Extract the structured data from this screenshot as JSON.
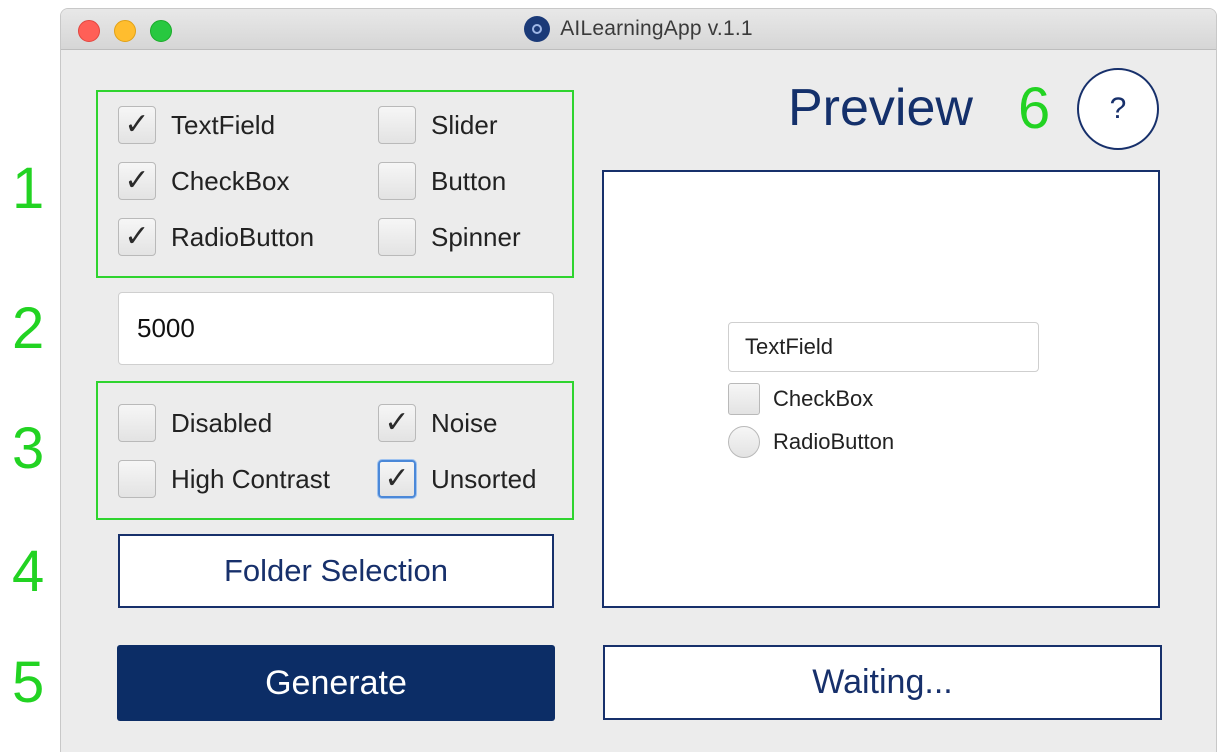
{
  "window": {
    "title": "AILearningApp v.1.1"
  },
  "annotations": [
    "1",
    "2",
    "3",
    "4",
    "5",
    "6"
  ],
  "components": [
    {
      "label": "TextField",
      "checked": true
    },
    {
      "label": "CheckBox",
      "checked": true
    },
    {
      "label": "RadioButton",
      "checked": true
    },
    {
      "label": "Slider",
      "checked": false
    },
    {
      "label": "Button",
      "checked": false
    },
    {
      "label": "Spinner",
      "checked": false
    }
  ],
  "count_input": {
    "value": "5000"
  },
  "options": [
    {
      "label": "Disabled",
      "checked": false
    },
    {
      "label": "High Contrast",
      "checked": false
    },
    {
      "label": "Noise",
      "checked": true
    },
    {
      "label": "Unsorted",
      "checked": true
    }
  ],
  "folder_button": {
    "label": "Folder Selection"
  },
  "generate_button": {
    "label": "Generate"
  },
  "preview": {
    "title": "Preview",
    "help_label": "?",
    "textfield_label": "TextField",
    "checkbox_label": "CheckBox",
    "radio_label": "RadioButton"
  },
  "status": {
    "label": "Waiting..."
  },
  "colors": {
    "accent": "#0c2d66",
    "annotation": "#2fd42f"
  },
  "icons": {
    "check": "✓"
  }
}
